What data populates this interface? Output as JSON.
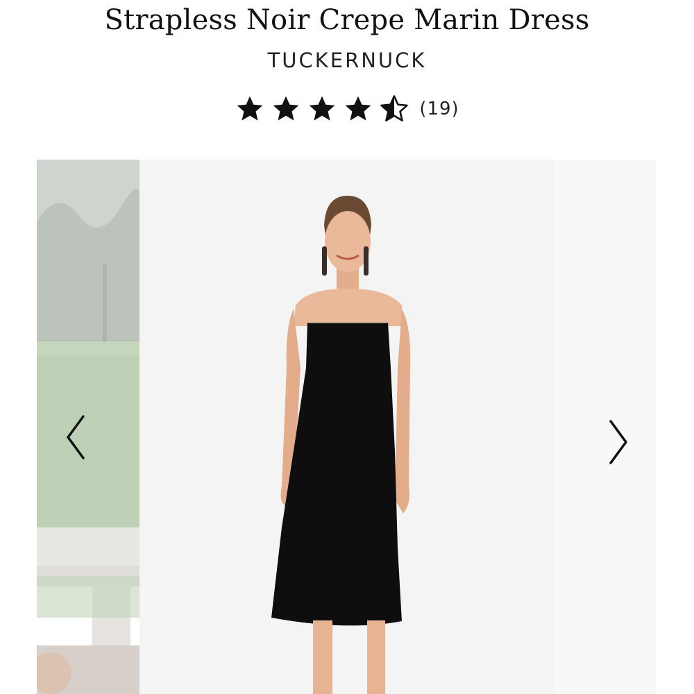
{
  "product": {
    "title": "Strapless Noir Crepe Marin Dress",
    "brand": "TUCKERNUCK",
    "rating": 4.5,
    "rating_max": 5,
    "review_count_text": "(19)"
  },
  "gallery": {
    "prev_slide_description_icon": "outdoor-lawn-photo",
    "main_image_icon": "model-black-strapless-dress-photo",
    "prev_arrow_icon": "chevron-left-icon",
    "next_arrow_icon": "chevron-right-icon"
  },
  "colors": {
    "text": "#111111",
    "star_fill": "#111111",
    "main_bg": "#f4f4f4",
    "dress": "#0e0e0e",
    "skin": "#e9b99a"
  }
}
